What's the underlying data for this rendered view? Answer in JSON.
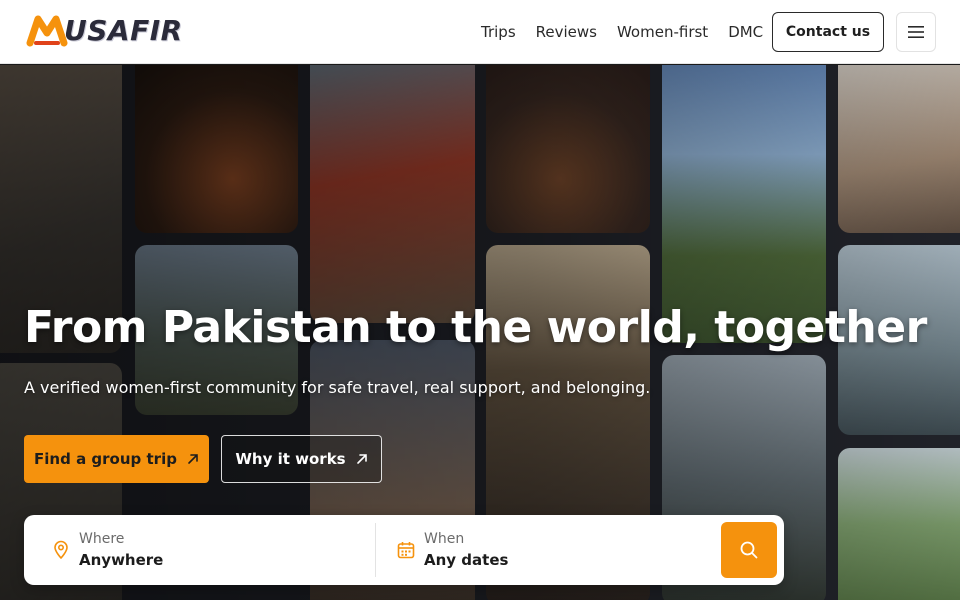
{
  "brand": {
    "logo_text": "USAFIR",
    "logo_mark_label": "M",
    "accent": "#f5920d",
    "dark": "#2b2b3a"
  },
  "nav": {
    "items": [
      {
        "label": "Trips"
      },
      {
        "label": "Reviews"
      },
      {
        "label": "Women-first"
      },
      {
        "label": "DMC"
      }
    ],
    "contact_label": "Contact us",
    "menu_icon": "hamburger-icon"
  },
  "hero": {
    "title": "From Pakistan to the world, together",
    "subtitle": "A verified women-first community for safe travel, real support, and belonging.",
    "primary_cta": "Find a group trip",
    "secondary_cta": "Why it works",
    "cta_icon": "arrow-up-right-icon"
  },
  "search": {
    "where_label": "Where",
    "where_value": "Anywhere",
    "where_icon": "map-pin-icon",
    "when_label": "When",
    "when_value": "Any dates",
    "when_icon": "calendar-icon",
    "submit_icon": "search-icon"
  }
}
